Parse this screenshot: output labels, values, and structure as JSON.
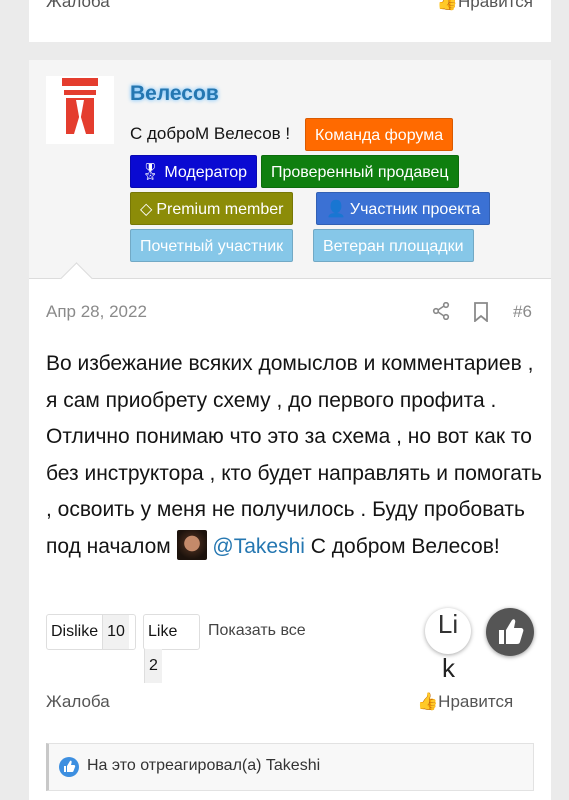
{
  "previous_post": {
    "report_label": "Жалоба",
    "like_label": "Нравится"
  },
  "post": {
    "username": "Велесов",
    "greeting": "С доброМ Велесов !",
    "badges": {
      "team": "Команда форума",
      "moderator": "Модератор",
      "verified_seller": "Проверенный продавец",
      "premium": "Premium member",
      "member": "Участник проекта",
      "honored": "Почетный участник",
      "veteran": "Ветеран площадки"
    },
    "date": "Апр 28, 2022",
    "post_number": "#6",
    "body_main": "Во избежание всяких домыслов и комментариев , я сам приобрету схему , до первого профита . Отлично понимаю что это за схема , но вот как то без инструктора , кто будет направлять и помогать , освоить у меня не получилось . Буду пробовать под началом",
    "mention": "@Takeshi",
    "body_tail": " С добром Велесов!",
    "reactions": {
      "dislike_label": "Dislike",
      "dislike_count": "10",
      "like_label": "Like",
      "like_count": "2",
      "show_all": "Показать все"
    },
    "fab_like_text": "Li",
    "fab_like_text2": "k",
    "report_label": "Жалоба",
    "like_label": "Нравится",
    "reacted_text": "На это отреагировал(а) Takeshi"
  },
  "colors": {
    "username": "#2577b1",
    "team": "#ff6a00",
    "moderator": "#0a0ad2",
    "seller": "#0f7f0f",
    "premium": "#8c8c08",
    "member": "#3b71d4",
    "honor": "#86c7e8"
  }
}
